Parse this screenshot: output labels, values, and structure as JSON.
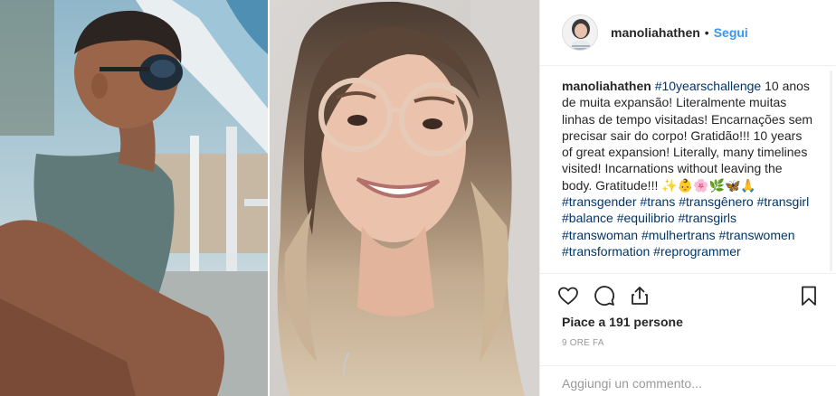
{
  "post": {
    "username": "manoliahathen",
    "separator": "•",
    "follow_label": "Segui"
  },
  "caption": {
    "username": "manoliahathen",
    "lead_hashtag": "#10yearschallenge",
    "text": " 10 anos de muita expansão! Literalmente muitas linhas de tempo visitadas! Encarnações sem precisar sair do corpo! Gratidão!!! 10 years of great expansion! Literally, many timelines visited! Incarnations without leaving the body. Gratitude!!! ✨👶🌸🌿🦋🙏 ",
    "hashtags": [
      "#transgender",
      "#trans",
      "#transgênero",
      "#transgirl",
      "#balance",
      "#equilibrio",
      "#transgirls",
      "#transwoman",
      "#mulhertrans",
      "#transwomen",
      "#transformation",
      "#reprogrammer"
    ]
  },
  "actions": {
    "icons": [
      "heart-icon",
      "comment-icon",
      "share-icon",
      "bookmark-icon"
    ],
    "likes_text": "Piace a 191 persone",
    "time_text": "9 ORE FA"
  },
  "comment": {
    "placeholder": "Aggiungi un commento..."
  },
  "colors": {
    "follow": "#3897f0",
    "hashtag": "#003569",
    "meta": "#999999",
    "divider": "#efefef"
  }
}
